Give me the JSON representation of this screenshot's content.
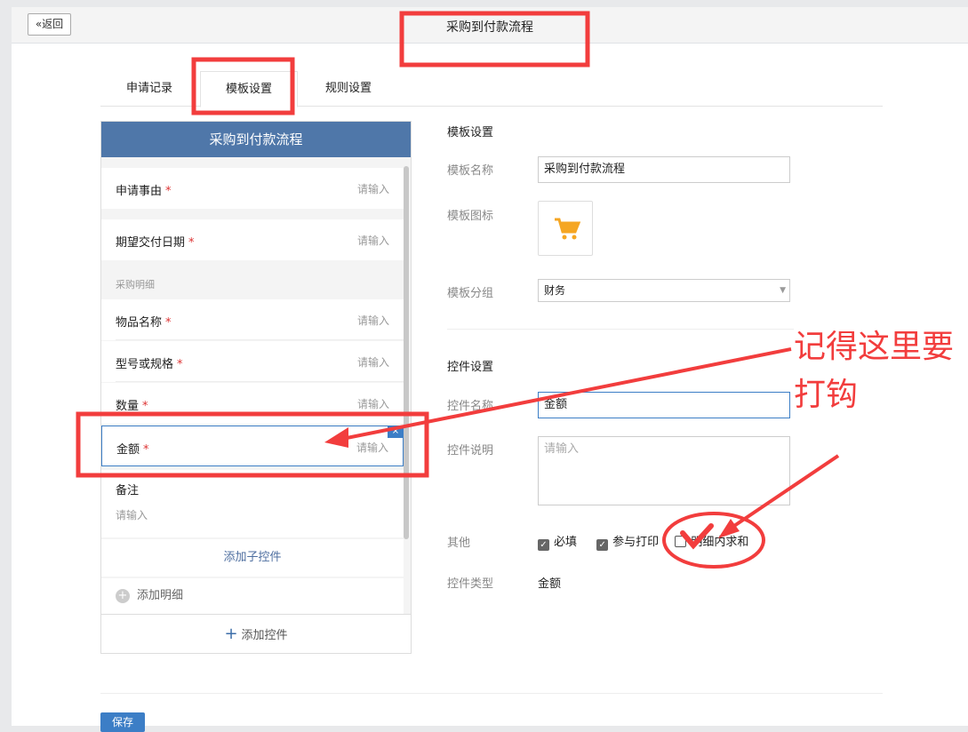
{
  "header": {
    "back_label": "«返回",
    "title": "采购到付款流程"
  },
  "tabs": [
    {
      "label": "申请记录"
    },
    {
      "label": "模板设置"
    },
    {
      "label": "规则设置"
    }
  ],
  "preview": {
    "title": "采购到付款流程",
    "fields": [
      {
        "label": "申请事由",
        "placeholder": "请输入"
      },
      {
        "label": "期望交付日期",
        "placeholder": "请输入"
      }
    ],
    "section": "采购明细",
    "detail_fields": [
      {
        "label": "物品名称",
        "placeholder": "请输入"
      },
      {
        "label": "型号或规格",
        "placeholder": "请输入"
      },
      {
        "label": "数量",
        "placeholder": "请输入"
      },
      {
        "label": "金额",
        "placeholder": "请输入"
      }
    ],
    "remark": {
      "label": "备注",
      "placeholder": "请输入"
    },
    "required_mark": "*",
    "close": "×",
    "add_child": "添加子控件",
    "add_detail": "添加明细",
    "add_control": "添加控件"
  },
  "template": {
    "heading": "模板设置",
    "name_label": "模板名称",
    "name_value": "采购到付款流程",
    "icon_label": "模板图标",
    "icon": "cart-icon",
    "group_label": "模板分组",
    "group_value": "财务"
  },
  "control": {
    "heading": "控件设置",
    "name_label": "控件名称",
    "name_value": "金额",
    "desc_label": "控件说明",
    "desc_placeholder": "请输入",
    "other_label": "其他",
    "options": [
      {
        "label": "必填",
        "checked": true
      },
      {
        "label": "参与打印",
        "checked": true
      },
      {
        "label": "明细内求和",
        "checked": false
      }
    ],
    "type_label": "控件类型",
    "type_value": "金额"
  },
  "save_label": "保存",
  "annotation": {
    "text": "记得这里要打钩",
    "color": "#f23d3d"
  }
}
